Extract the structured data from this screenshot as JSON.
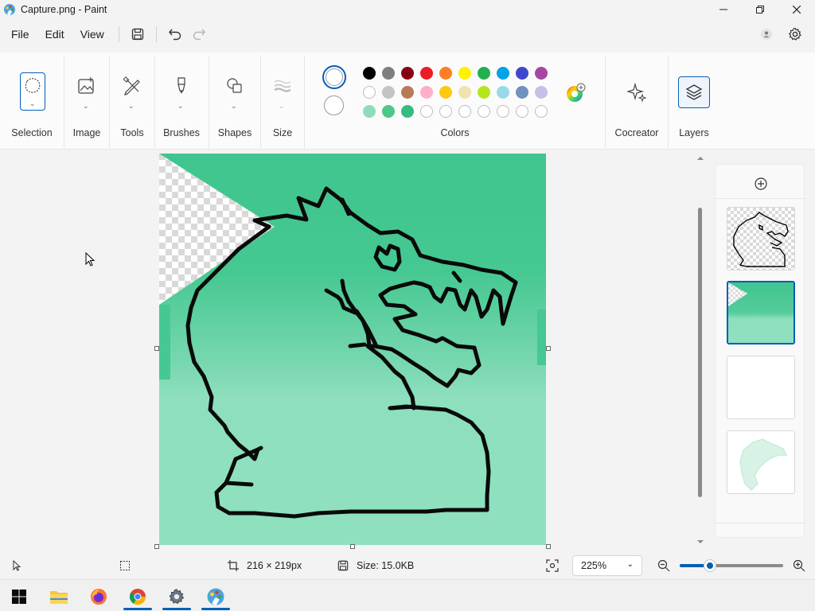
{
  "window": {
    "title": "Capture.png - Paint",
    "icon": "paint-palette-icon",
    "controls": [
      "minimize-icon",
      "maximize-icon",
      "close-icon"
    ]
  },
  "menu": {
    "items": [
      "File",
      "Edit",
      "View"
    ]
  },
  "ribbon": {
    "groups": {
      "selection": "Selection",
      "image": "Image",
      "tools": "Tools",
      "brushes": "Brushes",
      "shapes": "Shapes",
      "size": "Size",
      "colors": "Colors",
      "cocreator": "Cocreator",
      "layers": "Layers"
    },
    "palette": [
      [
        "#000000",
        "#7f7f7f",
        "#880015",
        "#ed1c24",
        "#ff7f27",
        "#fff200",
        "#22b14c",
        "#00a2e8",
        "#3f48cc",
        "#a349a4"
      ],
      [
        "#ffffff",
        "#c3c3c3",
        "#b97a57",
        "#ffaec9",
        "#ffc90e",
        "#efe4b0",
        "#b5e61d",
        "#99d9ea",
        "#7092be",
        "#c8bfe7"
      ],
      [
        "#8fdcb9",
        "#4cc88a",
        "#38bb80",
        "",
        "",
        "",
        "",
        "",
        "",
        ""
      ]
    ]
  },
  "status": {
    "dimensions": "216 × 219px",
    "size": "Size: 15.0KB",
    "zoom": "225%",
    "zoom_level_fraction": 0.29
  },
  "taskbar": {
    "apps": [
      "windows-start-icon",
      "file-explorer-icon",
      "firefox-icon",
      "chrome-icon",
      "settings-icon",
      "paint-icon"
    ]
  }
}
